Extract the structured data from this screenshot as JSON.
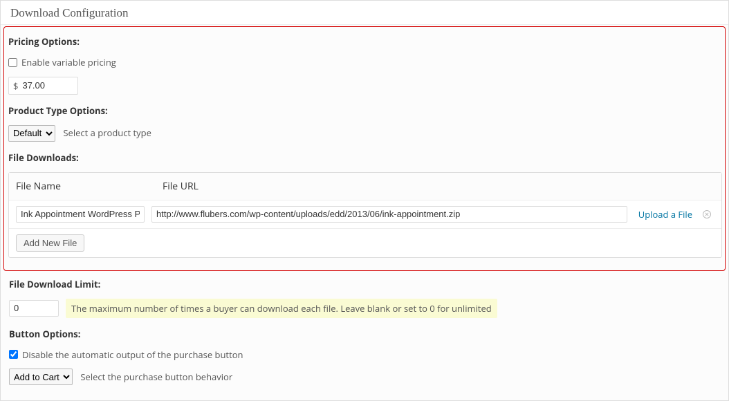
{
  "metabox": {
    "title": "Download Configuration"
  },
  "pricing": {
    "label": "Pricing Options:",
    "enable_variable_label": "Enable variable pricing",
    "currency_symbol": "$",
    "price": "37.00"
  },
  "product_type": {
    "label": "Product Type Options:",
    "selected": "Default",
    "desc": "Select a product type"
  },
  "file_downloads": {
    "label": "File Downloads:",
    "col_name": "File Name",
    "col_url": "File URL",
    "rows": [
      {
        "name": "Ink Appointment WordPress Plu",
        "url": "http://www.flubers.com/wp-content/uploads/edd/2013/06/ink-appointment.zip"
      }
    ],
    "upload_label": "Upload a File",
    "add_button": "Add New File"
  },
  "download_limit": {
    "label": "File Download Limit:",
    "value": "0",
    "desc": "The maximum number of times a buyer can download each file. Leave blank or set to 0 for unlimited"
  },
  "button_options": {
    "label": "Button Options:",
    "disable_auto_label": "Disable the automatic output of the purchase button",
    "behavior_selected": "Add to Cart",
    "behavior_desc": "Select the purchase button behavior"
  }
}
